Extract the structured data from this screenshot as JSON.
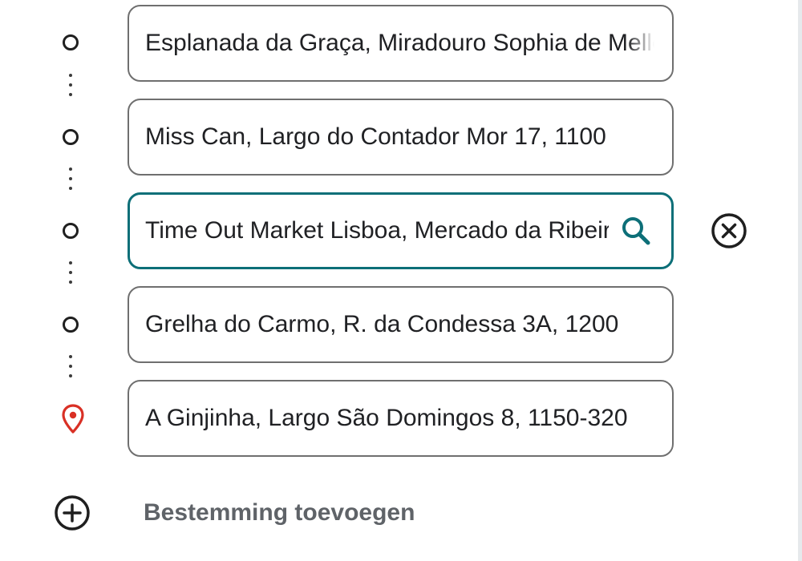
{
  "waypoints": [
    {
      "value": "Esplanada da Graça, Miradouro Sophia de Mello Breyner Andresen",
      "icon": "circle-icon",
      "active": false
    },
    {
      "value": "Miss Can, Largo do Contador Mor 17, 1100",
      "icon": "circle-icon",
      "active": false
    },
    {
      "value": "Time Out Market Lisboa, Mercado da Ribeira",
      "icon": "circle-icon",
      "active": true
    },
    {
      "value": "Grelha do Carmo, R. da Condessa 3A, 1200",
      "icon": "circle-icon",
      "active": false
    },
    {
      "value": "A Ginjinha, Largo São Domingos 8, 1150-320",
      "icon": "location-pin-icon",
      "active": false
    }
  ],
  "active_field_actions": {
    "search_icon": "search-icon",
    "remove_icon": "remove-waypoint-icon"
  },
  "add_destination": {
    "label": "Bestemming toevoegen",
    "icon": "add-circle-icon"
  },
  "colors": {
    "active_border": "#0d6f78",
    "pin_red": "#d93025",
    "text_primary": "#202124",
    "text_secondary": "#5f6368"
  }
}
